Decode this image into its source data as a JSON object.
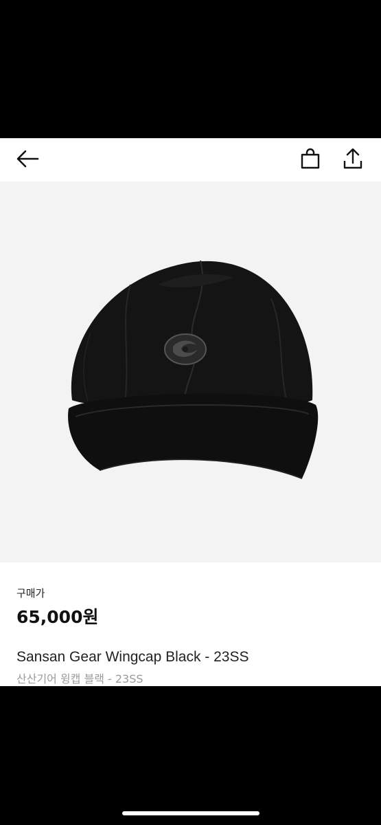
{
  "header": {
    "back_icon": "arrow-left-icon",
    "bag_icon": "shopping-bag-icon",
    "share_icon": "share-upload-icon"
  },
  "product": {
    "image_alt": "black cap",
    "price_label": "구매가",
    "price": "65,000원",
    "title": "Sansan Gear Wingcap Black - 23SS",
    "subtitle": "산산기어 윙캡 블랙 - 23SS"
  },
  "colors": {
    "background": "#ffffff",
    "image_bg": "#f3f3f3",
    "text_primary": "#111111",
    "text_secondary": "#9a9a9a"
  }
}
